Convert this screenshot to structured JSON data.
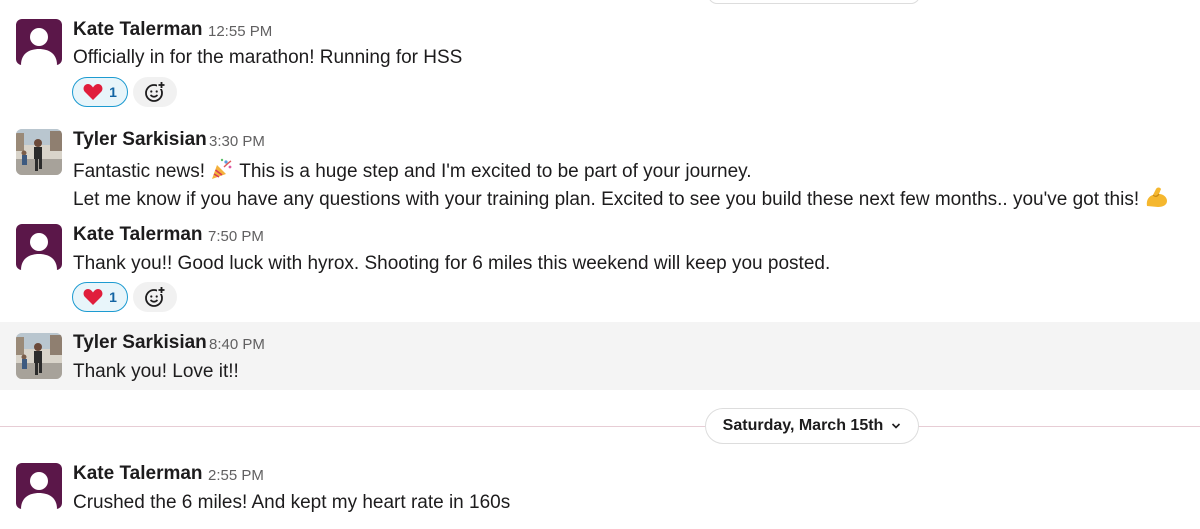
{
  "messages": [
    {
      "author": "Kate Talerman",
      "time": "12:55 PM",
      "lines": [
        "Officially in for the marathon! Running for HSS"
      ],
      "reaction": {
        "emoji": "heart-icon",
        "count": "1"
      }
    },
    {
      "author": "Tyler Sarkisian",
      "time": "3:30 PM",
      "lines": [
        "Fantastic news!",
        "This is a huge step and I'm excited to be part of your journey.",
        "Let me know if you have any questions with your training plan. Excited to see you build these next few months.. you've got this!"
      ]
    },
    {
      "author": "Kate Talerman",
      "time": "7:50 PM",
      "lines": [
        "Thank you!! Good luck with hyrox. Shooting for 6 miles this weekend will keep you posted."
      ],
      "reaction": {
        "emoji": "heart-icon",
        "count": "1"
      }
    },
    {
      "author": "Tyler Sarkisian",
      "time": "8:40 PM",
      "lines": [
        "Thank you! Love it!!"
      ]
    },
    {
      "author": "Kate Talerman",
      "time": "2:55 PM",
      "lines": [
        "Crushed the 6 miles! And kept my heart rate in 160s"
      ]
    }
  ],
  "date_divider": {
    "label": "Saturday, March 15th"
  },
  "colors": {
    "kate_avatar": "#5b1749",
    "reaction_border": "#1d9bd1",
    "reaction_count": "#1264a3",
    "highlight_bg": "#f4f4f4"
  }
}
